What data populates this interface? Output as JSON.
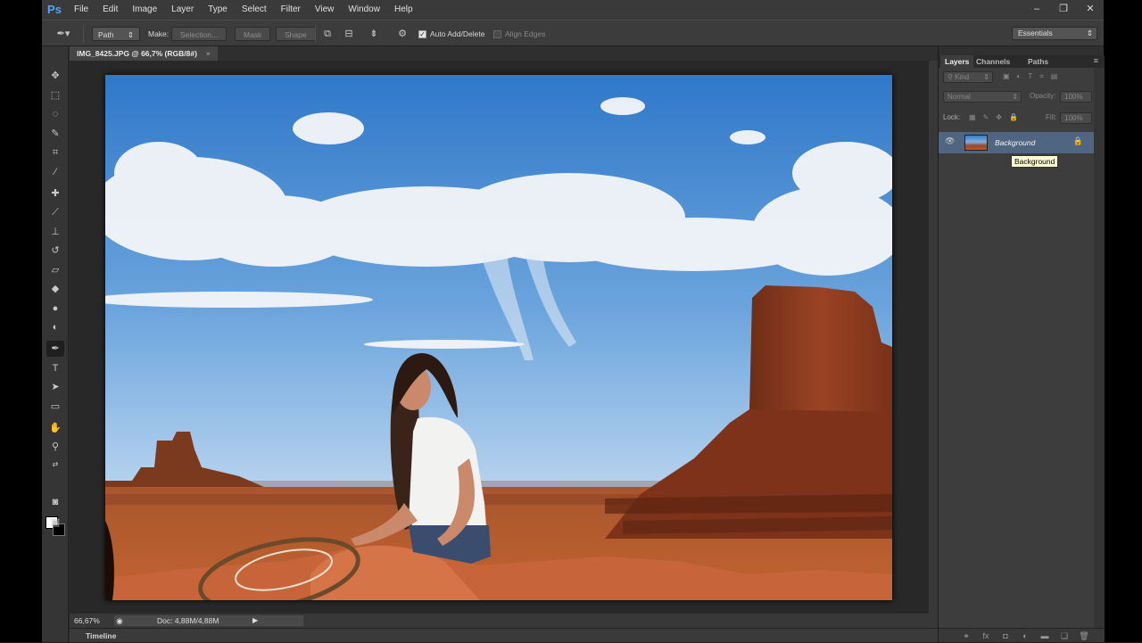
{
  "app": {
    "logo": "Ps"
  },
  "menu": [
    "File",
    "Edit",
    "Image",
    "Layer",
    "Type",
    "Select",
    "Filter",
    "View",
    "Window",
    "Help"
  ],
  "window_controls": {
    "minimize": "–",
    "restore": "❐",
    "close": "✕"
  },
  "options": {
    "tool_mode": "Path",
    "make_label": "Make:",
    "selection_btn": "Selection...",
    "mask_btn": "Mask",
    "shape_btn": "Shape",
    "auto_add_delete": "Auto Add/Delete",
    "auto_add_delete_checked": true,
    "align_edges": "Align Edges",
    "align_edges_checked": false,
    "workspace": "Essentials"
  },
  "document": {
    "tab_title": "IMG_8425.JPG @ 66,7% (RGB/8#)",
    "tab_close": "×",
    "zoom": "66,67%",
    "doc_size": "Doc: 4,88M/4,88M"
  },
  "timeline": {
    "label": "Timeline"
  },
  "layers_panel": {
    "tabs": [
      "Layers",
      "Channels",
      "Paths"
    ],
    "filter_kind": "Kind",
    "blend_mode": "Normal",
    "opacity_label": "Opacity:",
    "opacity_value": "100%",
    "lock_label": "Lock:",
    "fill_label": "Fill:",
    "fill_value": "100%",
    "layers": [
      {
        "name": "Background",
        "locked": true,
        "visible": true,
        "selected": true
      }
    ],
    "tooltip": "Background"
  },
  "icons": {
    "tools": [
      "move-icon",
      "marquee-icon",
      "lasso-icon",
      "quick-selection-icon",
      "crop-icon",
      "eyedropper-icon",
      "spot-healing-icon",
      "brush-icon",
      "clone-stamp-icon",
      "history-brush-icon",
      "eraser-icon",
      "paint-bucket-icon",
      "blur-icon",
      "dodge-icon",
      "pen-icon",
      "type-icon",
      "path-selection-icon",
      "rectangle-icon",
      "hand-icon",
      "zoom-icon"
    ]
  },
  "colors": {
    "accent": "#4ca4ff",
    "selected_layer": "#506580",
    "tooltip_bg": "#fcfcd0"
  }
}
